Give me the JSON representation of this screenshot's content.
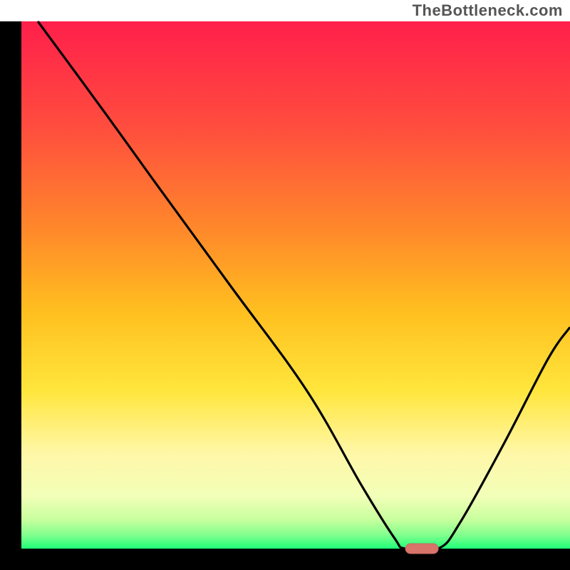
{
  "watermark": "TheBottleneck.com",
  "colors": {
    "axis": "#000000",
    "curve": "#000000",
    "marker_fill": "#d9746a",
    "marker_stroke": "#c3685f",
    "gradient_stops": [
      {
        "offset": 0.0,
        "color": "#ff1f4b"
      },
      {
        "offset": 0.2,
        "color": "#ff4d3e"
      },
      {
        "offset": 0.4,
        "color": "#ff8a2a"
      },
      {
        "offset": 0.55,
        "color": "#ffbf1f"
      },
      {
        "offset": 0.7,
        "color": "#ffe63c"
      },
      {
        "offset": 0.82,
        "color": "#fff7a8"
      },
      {
        "offset": 0.9,
        "color": "#f2ffb8"
      },
      {
        "offset": 0.945,
        "color": "#c8ff9e"
      },
      {
        "offset": 0.975,
        "color": "#7fff8d"
      },
      {
        "offset": 1.0,
        "color": "#1eff78"
      }
    ]
  },
  "chart_data": {
    "type": "line",
    "title": "",
    "xlabel": "",
    "ylabel": "",
    "xlim": [
      0,
      100
    ],
    "ylim": [
      0,
      100
    ],
    "marker": {
      "x": 73,
      "y": 0
    },
    "series": [
      {
        "name": "bottleneck-curve",
        "points": [
          {
            "x": 3,
            "y": 100
          },
          {
            "x": 15,
            "y": 83
          },
          {
            "x": 24,
            "y": 70
          },
          {
            "x": 38,
            "y": 50
          },
          {
            "x": 52,
            "y": 30
          },
          {
            "x": 62,
            "y": 12
          },
          {
            "x": 68,
            "y": 2
          },
          {
            "x": 70,
            "y": 0
          },
          {
            "x": 76,
            "y": 0
          },
          {
            "x": 80,
            "y": 5
          },
          {
            "x": 88,
            "y": 20
          },
          {
            "x": 96,
            "y": 36
          },
          {
            "x": 100,
            "y": 42
          }
        ]
      }
    ]
  }
}
